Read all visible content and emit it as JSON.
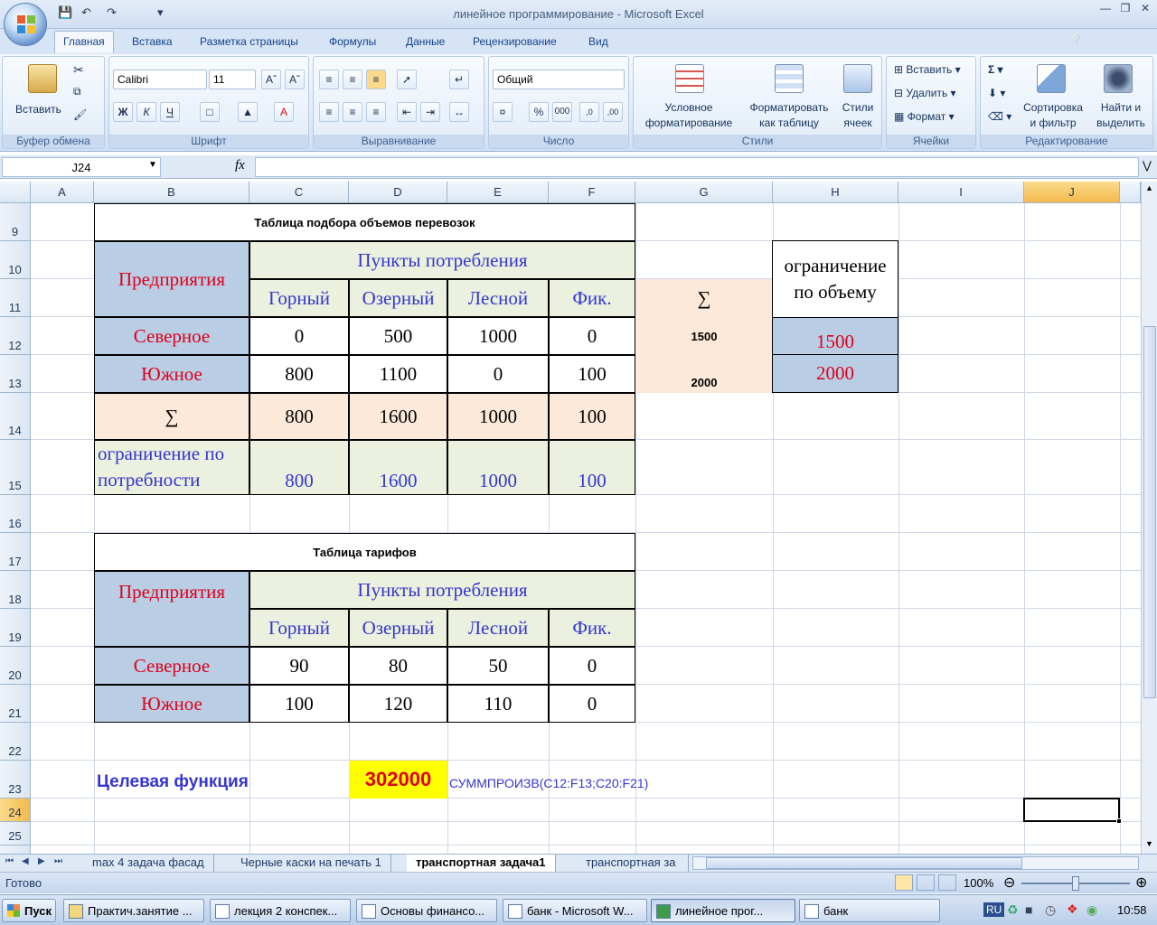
{
  "window": {
    "title": "линейное программирование - Microsoft Excel"
  },
  "ribbon": {
    "tabs": [
      "Главная",
      "Вставка",
      "Разметка страницы",
      "Формулы",
      "Данные",
      "Рецензирование",
      "Вид"
    ],
    "groups": {
      "clipboard": {
        "label": "Буфер обмена",
        "paste": "Вставить"
      },
      "font": {
        "label": "Шрифт",
        "font_name": "Calibri",
        "font_size": "11",
        "bold": "Ж",
        "italic": "К",
        "underline": "Ч"
      },
      "alignment": {
        "label": "Выравнивание"
      },
      "number": {
        "label": "Число",
        "format": "Общий"
      },
      "styles": {
        "label": "Стили",
        "cond_format_1": "Условное",
        "cond_format_2": "форматирование",
        "format_table_1": "Форматировать",
        "format_table_2": "как таблицу",
        "cell_styles_1": "Стили",
        "cell_styles_2": "ячеек"
      },
      "cells": {
        "label": "Ячейки",
        "insert": "Вставить",
        "delete": "Удалить",
        "format": "Формат"
      },
      "editing": {
        "label": "Редактирование",
        "sort_1": "Сортировка",
        "sort_2": "и фильтр",
        "find_1": "Найти и",
        "find_2": "выделить"
      }
    }
  },
  "formula_bar": {
    "name_box": "J24",
    "fx": "fx",
    "formula": ""
  },
  "columns": [
    "A",
    "B",
    "C",
    "D",
    "E",
    "F",
    "G",
    "H",
    "I",
    "J"
  ],
  "rows": [
    "9",
    "10",
    "11",
    "12",
    "13",
    "14",
    "15",
    "16",
    "17",
    "18",
    "19",
    "20",
    "21",
    "22",
    "23",
    "24",
    "25"
  ],
  "table1": {
    "title": "Таблица подбора объемов перевозок",
    "enterprises_label": "Предприятия",
    "points_label": "Пункты потребления",
    "col_names": [
      "Горный",
      "Озерный",
      "Лесной",
      "Фик."
    ],
    "rows": [
      {
        "name": "Северное",
        "values": [
          "0",
          "500",
          "1000",
          "0"
        ],
        "sum": "1500",
        "limit": "1500"
      },
      {
        "name": "Южное",
        "values": [
          "800",
          "1100",
          "0",
          "100"
        ],
        "sum": "2000",
        "limit": "2000"
      }
    ],
    "sum_symbol": "∑",
    "col_sums": [
      "800",
      "1600",
      "1000",
      "100"
    ],
    "demand_label_1": "ограничение по",
    "demand_label_2": "потребности",
    "demand": [
      "800",
      "1600",
      "1000",
      "100"
    ],
    "volume_limit_label_1": "ограничение",
    "volume_limit_label_2": "по объему"
  },
  "table2": {
    "title": "Таблица тарифов",
    "enterprises_label": "Предприятия",
    "points_label": "Пункты потребления",
    "col_names": [
      "Горный",
      "Озерный",
      "Лесной",
      "Фик."
    ],
    "rows": [
      {
        "name": "Северное",
        "values": [
          "90",
          "80",
          "50",
          "0"
        ]
      },
      {
        "name": "Южное",
        "values": [
          "100",
          "120",
          "110",
          "0"
        ]
      }
    ]
  },
  "objective": {
    "label": "Целевая функция",
    "value": "302000",
    "formula": "СУММПРОИЗВ(C12:F13;C20:F21)"
  },
  "sheet_tabs": [
    "max 4 задача фасад",
    "Черные каски на печать 1",
    "транспортная задача1",
    "транспортная за"
  ],
  "status": {
    "ready": "Готово",
    "zoom": "100%"
  },
  "taskbar": {
    "start": "Пуск",
    "items": [
      "Практич.занятие ...",
      "лекция 2 конспек...",
      "Основы финансо...",
      "банк - Microsoft W...",
      "линейное прог...",
      "банк"
    ],
    "lang": "RU",
    "clock": "10:58"
  },
  "colors": {
    "accent_red": "#e0001b",
    "accent_blue": "#3535d0",
    "header_blue": "#b9cde5",
    "green": "#ebf1de",
    "peach": "#fde9d9",
    "highlight_yellow": "#ffff00"
  }
}
